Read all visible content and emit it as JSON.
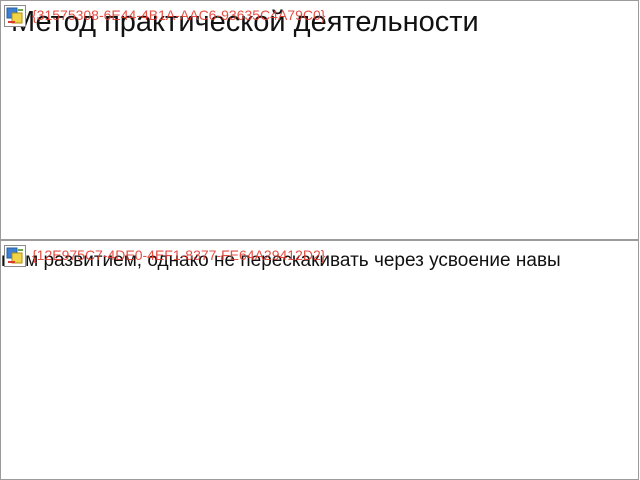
{
  "slides": [
    {
      "object_id": "{31575308-6E44-4B1A-AAC6-93635C4A79C0}",
      "text": "Метод практической деятельности",
      "icon": "embedded-object-icon"
    },
    {
      "object_id": "{12E975C7-4DE0-4EF1-8377-FE64A29412D2}",
      "text": "ным развитием, однако не перескакивать через усвоение навы",
      "icon": "embedded-object-icon"
    }
  ],
  "colors": {
    "object_id_text": "#e33b2f",
    "border": "#9b9b9b",
    "background": "#ffffff"
  }
}
